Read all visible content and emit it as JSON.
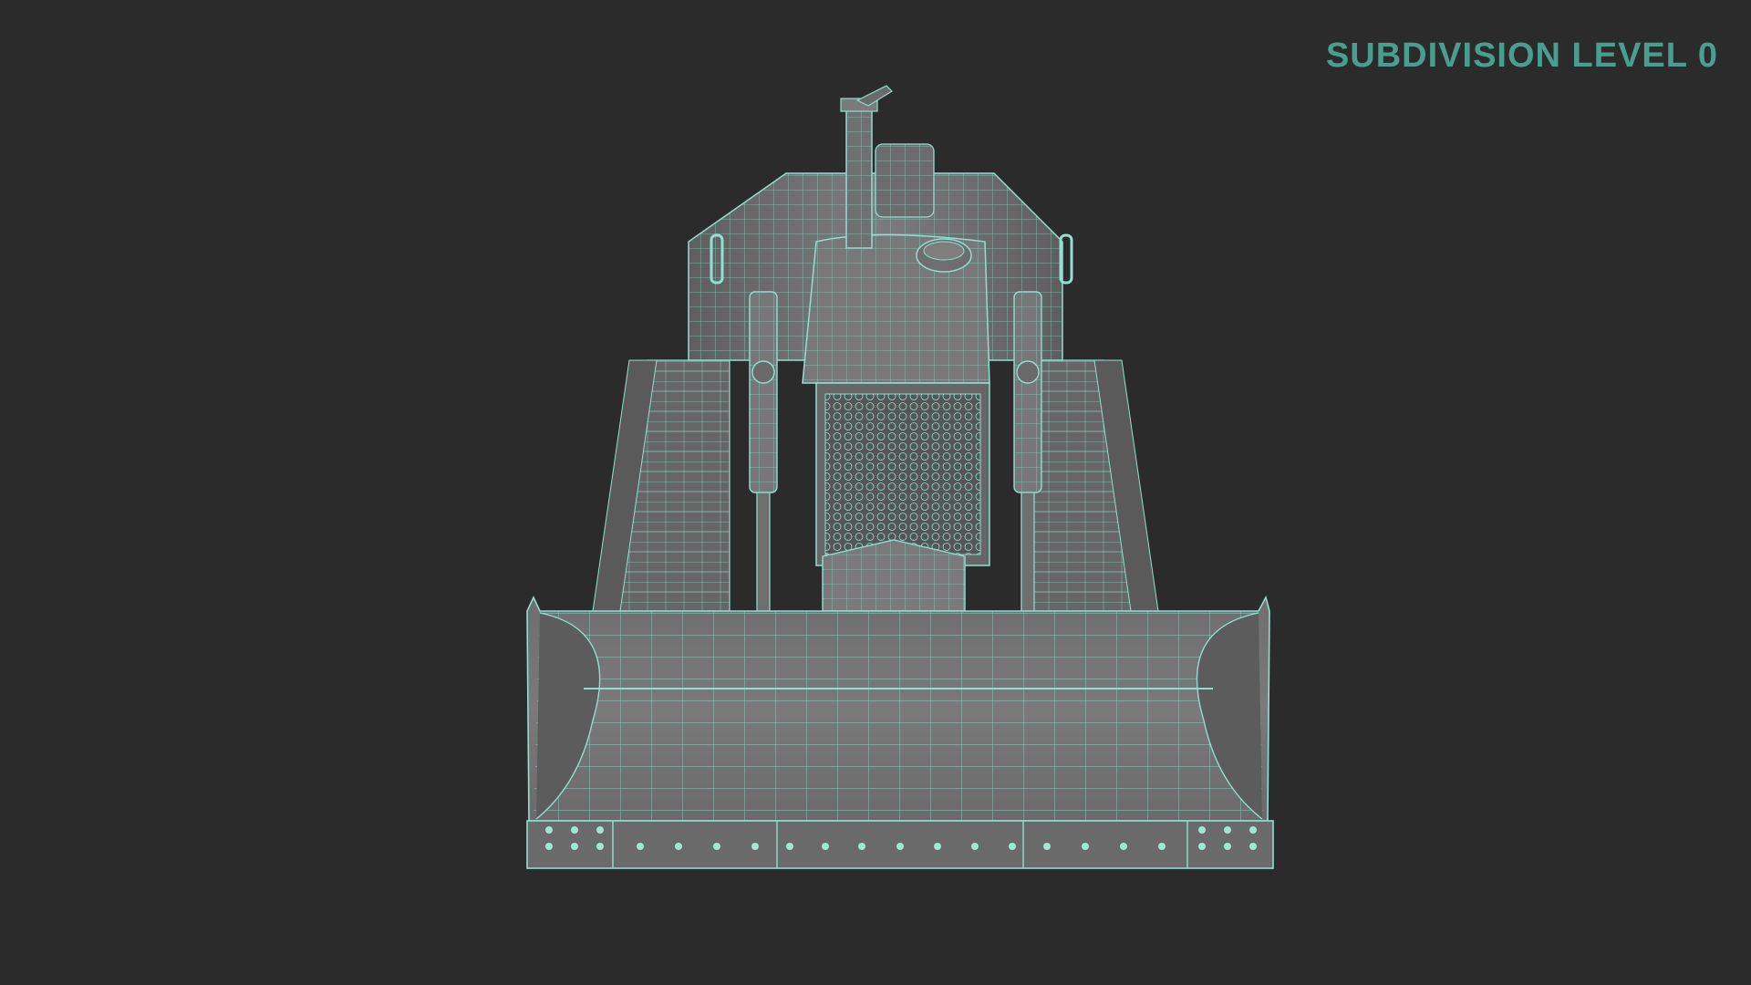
{
  "overlay": {
    "label": "SUBDIVISION LEVEL 0"
  },
  "colors": {
    "background": "#2b2b2b",
    "label": "#4a9e8d",
    "wire": "#8fe0cf",
    "body_light": "#7d7d7d",
    "body_mid": "#6a6a6a",
    "body_dark": "#555555"
  },
  "scene": {
    "subject": "bulldozer-wireframe-front-view"
  }
}
